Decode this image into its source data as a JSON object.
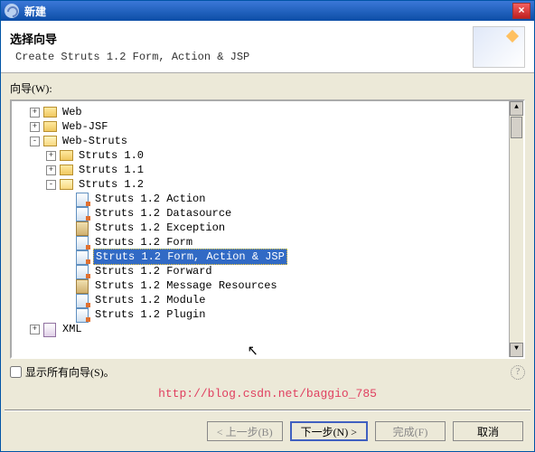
{
  "titlebar": {
    "title": "新建",
    "close_glyph": "×"
  },
  "banner": {
    "title": "选择向导",
    "subtitle": "Create Struts 1.2 Form, Action & JSP"
  },
  "wizards_label": "向导(W):",
  "tree": {
    "rows": [
      {
        "lvl": 1,
        "exp": "+",
        "icon": "folder",
        "label": "Web"
      },
      {
        "lvl": 1,
        "exp": "+",
        "icon": "folder",
        "label": "Web-JSF"
      },
      {
        "lvl": 1,
        "exp": "-",
        "icon": "folder-open",
        "label": "Web-Struts"
      },
      {
        "lvl": 2,
        "exp": "+",
        "icon": "folder",
        "label": "Struts 1.0"
      },
      {
        "lvl": 2,
        "exp": "+",
        "icon": "folder",
        "label": "Struts 1.1"
      },
      {
        "lvl": 2,
        "exp": "-",
        "icon": "folder-open",
        "label": "Struts 1.2"
      },
      {
        "lvl": 3,
        "icon": "gen",
        "label": "Struts 1.2 Action"
      },
      {
        "lvl": 3,
        "icon": "gen",
        "label": "Struts 1.2 Datasource"
      },
      {
        "lvl": 3,
        "icon": "mrc",
        "label": "Struts 1.2 Exception"
      },
      {
        "lvl": 3,
        "icon": "gen",
        "label": "Struts 1.2 Form"
      },
      {
        "lvl": 3,
        "icon": "gen",
        "label": "Struts 1.2 Form, Action & JSP",
        "sel": true
      },
      {
        "lvl": 3,
        "icon": "gen",
        "label": "Struts 1.2 Forward"
      },
      {
        "lvl": 3,
        "icon": "mrc",
        "label": "Struts 1.2 Message Resources"
      },
      {
        "lvl": 3,
        "icon": "gen",
        "label": "Struts 1.2 Module"
      },
      {
        "lvl": 3,
        "icon": "gen",
        "label": "Struts 1.2 Plugin"
      },
      {
        "lvl": 1,
        "exp": "+",
        "icon": "xml",
        "label": "XML"
      }
    ]
  },
  "showall": {
    "label": "显示所有向导(S)。",
    "help": "?"
  },
  "watermark": "http://blog.csdn.net/baggio_785",
  "buttons": {
    "back": "< 上一步(B)",
    "next": "下一步(N) >",
    "finish": "完成(F)",
    "cancel": "取消"
  }
}
